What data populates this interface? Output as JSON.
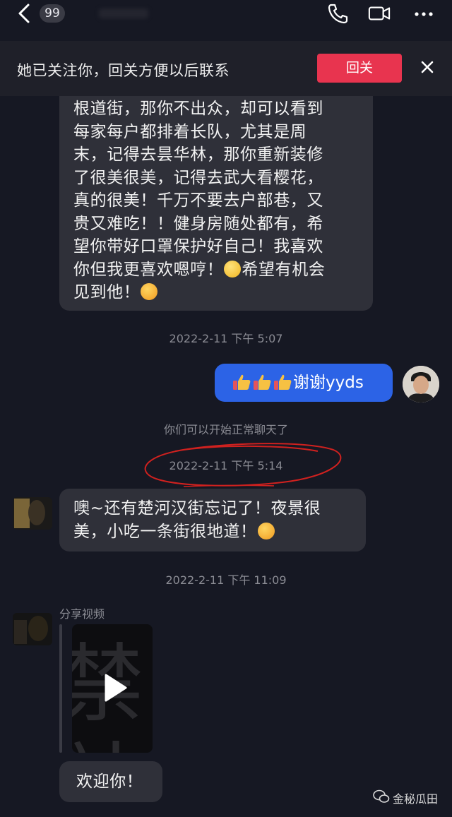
{
  "header": {
    "unread_count": "99"
  },
  "banner": {
    "text": "她已关注你，回关方便以后联系",
    "follow_button": "回关"
  },
  "messages": {
    "incoming_long": {
      "lines": [
        "根道街，那你不出众，却可以看到",
        "每家每户都排着长队，尤其是周",
        "末，记得去昙华林，那你重新装修",
        "了很美很美，记得去武大看樱花，",
        "真的很美！千万不要去户部巷，又",
        "贵又难吃！！健身房随处都有，希",
        "望你带好口罩保护好自己！我喜欢",
        "你但我更喜欢嗯哼！",
        "希望有机会",
        "见到他！"
      ]
    },
    "timestamp1": "2022-2-11 下午 5:07",
    "outgoing": {
      "text": "谢谢yyds",
      "thumbs_icon": "thumbs-up-emoji"
    },
    "system_notice": "你们可以开始正常聊天了",
    "timestamp2": "2022-2-11 下午 5:14",
    "incoming_short": {
      "lines": [
        "噢~还有楚河汉街忘记了！夜景很",
        "美，小吃一条街很地道！"
      ]
    },
    "timestamp3": "2022-2-11 下午 11:09",
    "share_label": "分享视频",
    "video_char": "禁站",
    "welcome": "欢迎你！"
  },
  "watermark": "金秘瓜田",
  "colors": {
    "background": "#161823",
    "incoming_bubble": "#2f3039",
    "outgoing_bubble": "#2c63e6",
    "follow_button": "#e8344f",
    "annotation_red": "#d0211f"
  }
}
